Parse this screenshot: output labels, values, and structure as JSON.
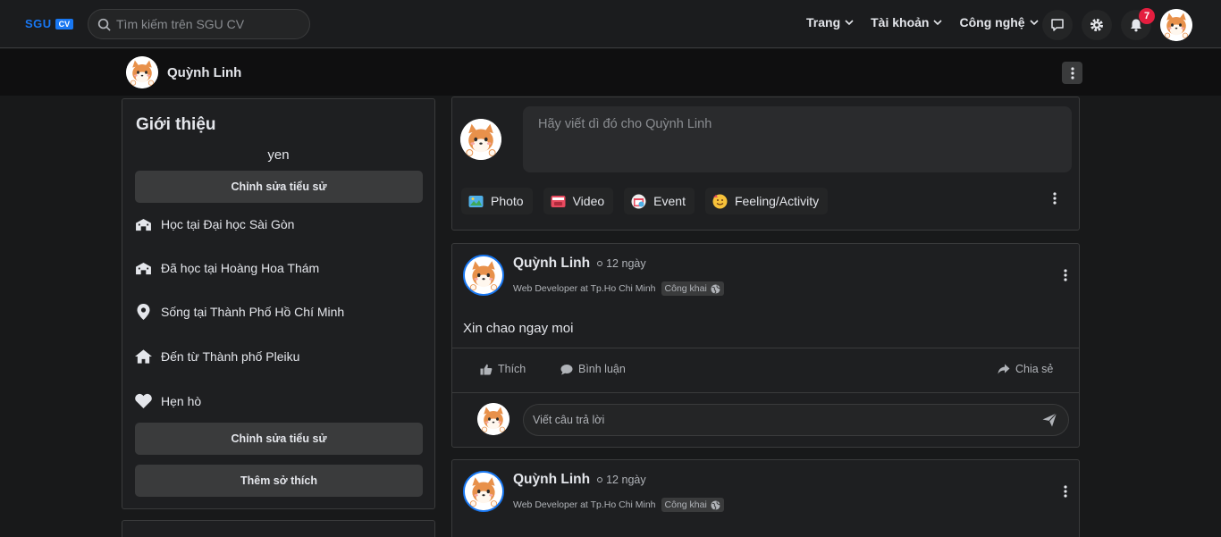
{
  "app": {
    "logo_text": "SGU",
    "logo_badge": "CV"
  },
  "search": {
    "placeholder": "Tìm kiếm trên SGU CV"
  },
  "nav": {
    "menus": [
      "Trang",
      "Tài khoản",
      "Công nghệ"
    ],
    "notification_count": "7"
  },
  "profile": {
    "name": "Quỳnh Linh"
  },
  "intro": {
    "title": "Giới thiệu",
    "bio": "yen",
    "edit_bio_label": "Chỉnh sửa tiểu sử",
    "items": [
      {
        "icon": "school-icon",
        "text": "Học tại Đại học Sài Gòn"
      },
      {
        "icon": "school-icon",
        "text": "Đã học tại Hoàng Hoa Thám"
      },
      {
        "icon": "location-pin-icon",
        "text": "Sống tại Thành Phố Hồ Chí Minh"
      },
      {
        "icon": "home-icon",
        "text": "Đến từ Thành phố Pleiku"
      },
      {
        "icon": "heart-icon",
        "text": "Hẹn hò"
      }
    ],
    "edit_bio_label_2": "Chỉnh sửa tiểu sử",
    "add_hobby_label": "Thêm sở thích"
  },
  "composer": {
    "placeholder": "Hãy viết dì đó cho Quỳnh  Linh",
    "actions": [
      "Photo",
      "Video",
      "Event",
      "Feeling/Activity"
    ]
  },
  "posts": [
    {
      "author": "Quỳnh Linh",
      "time": "12 ngày",
      "subtitle": "Web Developer at Tp.Ho Chi Minh",
      "privacy": "Công khai",
      "content": "Xin chao ngay moi",
      "like_label": "Thích",
      "comment_label": "Bình luận",
      "share_label": "Chia sẻ",
      "reply_placeholder": "Viết câu trả lời"
    },
    {
      "author": "Quỳnh Linh",
      "time": "12 ngày",
      "subtitle": "Web Developer at Tp.Ho Chi Minh",
      "privacy": "Công khai"
    }
  ],
  "colors": {
    "accent": "#1877f2",
    "badge": "#e41e3f",
    "background": "#18191a",
    "card": "#1e1f21"
  }
}
